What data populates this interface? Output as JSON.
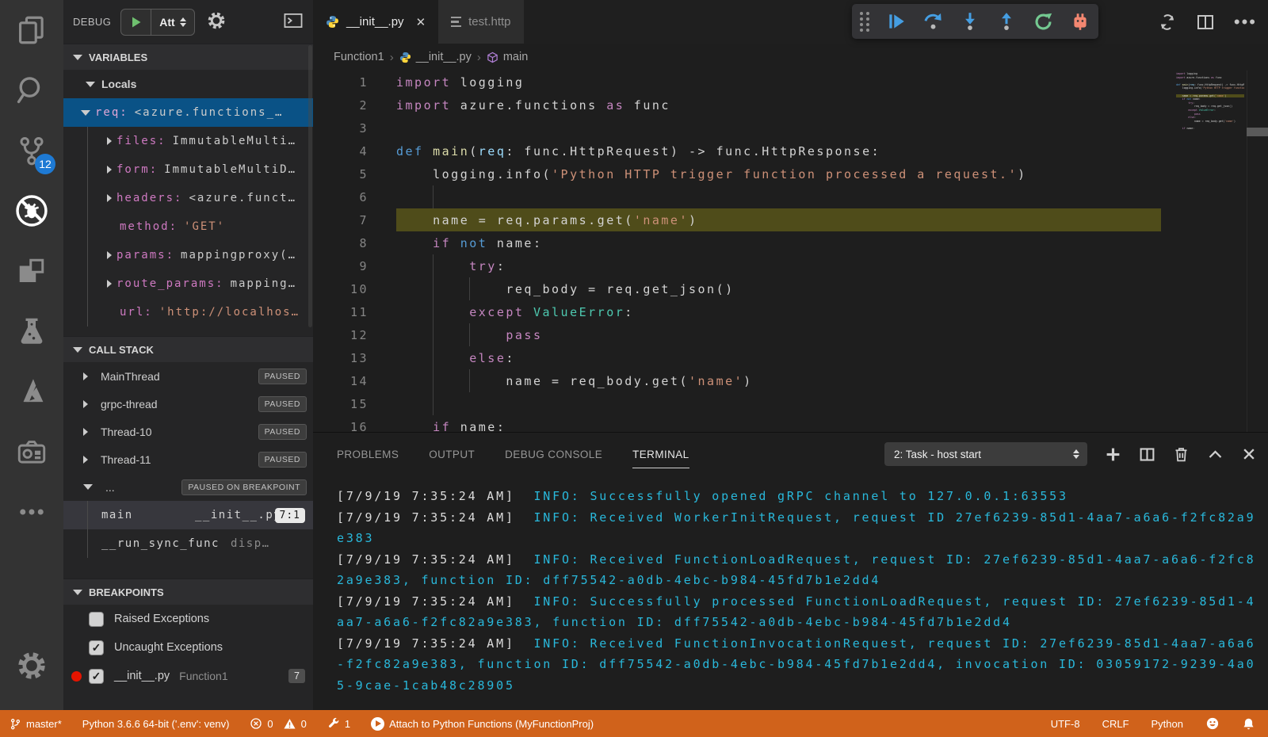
{
  "colors": {
    "status_bar_debugging": "#d0621b",
    "selection_blue": "#0a5286",
    "current_line_highlight": "#4f4c1a",
    "terminal_info_cyan": "#29b8db",
    "badge_blue": "#1E7AD4",
    "breakpoint_red": "#e51400",
    "breakpoint_arrow_yellow": "#f8c200"
  },
  "activity_bar": {
    "scm_badge": "12"
  },
  "debug_header": {
    "title": "DEBUG",
    "config": "Att"
  },
  "sidebar": {
    "variables": {
      "title": "VARIABLES",
      "scope": "Locals",
      "items": [
        {
          "name": "req:",
          "value": "<azure.functions_…",
          "depth": 0,
          "expanded": true,
          "selected": true,
          "string": false
        },
        {
          "name": "files:",
          "value": "ImmutableMulti…",
          "depth": 1,
          "arrow": true,
          "string": false
        },
        {
          "name": "form:",
          "value": "ImmutableMultiD…",
          "depth": 1,
          "arrow": true,
          "string": false
        },
        {
          "name": "headers:",
          "value": "<azure.funct…",
          "depth": 1,
          "arrow": true,
          "string": false
        },
        {
          "name": "method:",
          "value": "'GET'",
          "depth": 1,
          "arrow": false,
          "string": true
        },
        {
          "name": "params:",
          "value": "mappingproxy(…",
          "depth": 1,
          "arrow": true,
          "string": false
        },
        {
          "name": "route_params:",
          "value": "mapping…",
          "depth": 1,
          "arrow": true,
          "string": false
        },
        {
          "name": "url:",
          "value": "'http://localhos…",
          "depth": 1,
          "arrow": false,
          "string": true
        }
      ]
    },
    "call_stack": {
      "title": "CALL STACK",
      "threads": [
        {
          "label": "MainThread",
          "badge": "PAUSED",
          "expanded": false
        },
        {
          "label": "grpc-thread",
          "badge": "PAUSED",
          "expanded": false
        },
        {
          "label": "Thread-10",
          "badge": "PAUSED",
          "expanded": false
        },
        {
          "label": "Thread-11",
          "badge": "PAUSED",
          "expanded": false
        },
        {
          "label": "...",
          "badge": "PAUSED ON BREAKPOINT",
          "expanded": true
        }
      ],
      "frames": [
        {
          "fn": "main",
          "file": "__init__.py",
          "pos": "7:1",
          "active": true
        },
        {
          "fn": "__run_sync_func",
          "file": "disp…",
          "pos": "",
          "active": false
        }
      ]
    },
    "breakpoints": {
      "title": "BREAKPOINTS",
      "items": [
        {
          "label": "Raised Exceptions",
          "checked": false,
          "dot": false,
          "detail": "",
          "line": ""
        },
        {
          "label": "Uncaught Exceptions",
          "checked": true,
          "dot": false,
          "detail": "",
          "line": ""
        },
        {
          "label": "__init__.py",
          "checked": true,
          "dot": true,
          "detail": "Function1",
          "line": "7"
        }
      ]
    }
  },
  "editor": {
    "tabs": [
      {
        "label": "__init__.py",
        "active": true
      },
      {
        "label": "test.http",
        "active": false
      }
    ],
    "breadcrumbs": [
      "Function1",
      "__init__.py",
      "main"
    ],
    "current_line": 7,
    "code": [
      {
        "n": 1,
        "s": [
          [
            "pur",
            "import"
          ],
          [
            "pl",
            " logging"
          ]
        ]
      },
      {
        "n": 2,
        "s": [
          [
            "pur",
            "import"
          ],
          [
            "pl",
            " azure.functions "
          ],
          [
            "pur",
            "as"
          ],
          [
            "pl",
            " func"
          ]
        ]
      },
      {
        "n": 3,
        "s": []
      },
      {
        "n": 4,
        "s": [
          [
            "blu",
            "def"
          ],
          [
            "pl",
            " "
          ],
          [
            "yel",
            "main"
          ],
          [
            "pl",
            "("
          ],
          [
            "lbl",
            "req"
          ],
          [
            "pl",
            ": func.HttpRequest) -> func.HttpResponse:"
          ]
        ]
      },
      {
        "n": 5,
        "s": [
          [
            "pl",
            "    logging.info("
          ],
          [
            "str",
            "'Python HTTP trigger function processed a request.'"
          ],
          [
            "pl",
            ")"
          ]
        ]
      },
      {
        "n": 6,
        "s": []
      },
      {
        "n": 7,
        "s": [
          [
            "pl",
            "    name = req.params.get("
          ],
          [
            "str",
            "'name'"
          ],
          [
            "pl",
            ")"
          ]
        ],
        "bp": true
      },
      {
        "n": 8,
        "s": [
          [
            "pl",
            "    "
          ],
          [
            "pur",
            "if"
          ],
          [
            "pl",
            " "
          ],
          [
            "blu",
            "not"
          ],
          [
            "pl",
            " name:"
          ]
        ]
      },
      {
        "n": 9,
        "s": [
          [
            "pl",
            "        "
          ],
          [
            "pur",
            "try"
          ],
          [
            "pl",
            ":"
          ]
        ]
      },
      {
        "n": 10,
        "s": [
          [
            "pl",
            "            req_body = req.get_json()"
          ]
        ]
      },
      {
        "n": 11,
        "s": [
          [
            "pl",
            "        "
          ],
          [
            "pur",
            "except"
          ],
          [
            "pl",
            " "
          ],
          [
            "teal",
            "ValueError"
          ],
          [
            "pl",
            ":"
          ]
        ]
      },
      {
        "n": 12,
        "s": [
          [
            "pl",
            "            "
          ],
          [
            "pur",
            "pass"
          ]
        ]
      },
      {
        "n": 13,
        "s": [
          [
            "pl",
            "        "
          ],
          [
            "pur",
            "else"
          ],
          [
            "pl",
            ":"
          ]
        ]
      },
      {
        "n": 14,
        "s": [
          [
            "pl",
            "            name = req_body.get("
          ],
          [
            "str",
            "'name'"
          ],
          [
            "pl",
            ")"
          ]
        ]
      },
      {
        "n": 15,
        "s": []
      },
      {
        "n": 16,
        "s": [
          [
            "pl",
            "    "
          ],
          [
            "pur",
            "if"
          ],
          [
            "pl",
            " name:"
          ]
        ]
      }
    ]
  },
  "panel": {
    "tabs": [
      "PROBLEMS",
      "OUTPUT",
      "DEBUG CONSOLE",
      "TERMINAL"
    ],
    "active_tab": "TERMINAL",
    "terminal_select": "2: Task - host start",
    "terminal_lines": [
      {
        "time": "[7/9/19 7:35:24 AM]",
        "msg": "INFO: Successfully opened gRPC channel to 127.0.0.1:63553"
      },
      {
        "time": "[7/9/19 7:35:24 AM]",
        "msg": "INFO: Received WorkerInitRequest, request ID 27ef6239-85d1-4aa7-a6a6-f2fc82a9e383"
      },
      {
        "time": "[7/9/19 7:35:24 AM]",
        "msg": "INFO: Received FunctionLoadRequest, request ID: 27ef6239-85d1-4aa7-a6a6-f2fc82a9e383, function ID: dff75542-a0db-4ebc-b984-45fd7b1e2dd4"
      },
      {
        "time": "[7/9/19 7:35:24 AM]",
        "msg": "INFO: Successfully processed FunctionLoadRequest, request ID: 27ef6239-85d1-4aa7-a6a6-f2fc82a9e383, function ID: dff75542-a0db-4ebc-b984-45fd7b1e2dd4"
      },
      {
        "time": "[7/9/19 7:35:24 AM]",
        "msg": "INFO: Received FunctionInvocationRequest, request ID: 27ef6239-85d1-4aa7-a6a6-f2fc82a9e383, function ID: dff75542-a0db-4ebc-b984-45fd7b1e2dd4, invocation ID: 03059172-9239-4a05-9cae-1cab48c28905"
      }
    ]
  },
  "status_bar": {
    "branch": "master*",
    "interpreter": "Python 3.6.6 64-bit ('.env': venv)",
    "errors": "0",
    "warnings": "0",
    "tasks": "1",
    "attach": "Attach to Python Functions (MyFunctionProj)",
    "encoding": "UTF-8",
    "eol": "CRLF",
    "language": "Python"
  }
}
